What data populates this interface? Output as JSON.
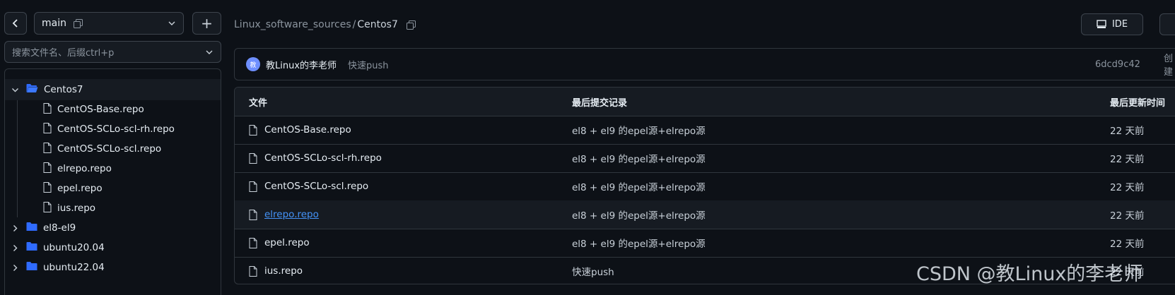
{
  "sidebar": {
    "branch": "main",
    "plus_label": "+",
    "search_placeholder": "搜索文件名、后缀ctrl+p",
    "tree": [
      {
        "label": "Centos7",
        "kind": "folder-open",
        "level": 0,
        "selected": true
      },
      {
        "label": "CentOS-Base.repo",
        "kind": "file",
        "level": 1
      },
      {
        "label": "CentOS-SCLo-scl-rh.repo",
        "kind": "file",
        "level": 1
      },
      {
        "label": "CentOS-SCLo-scl.repo",
        "kind": "file",
        "level": 1
      },
      {
        "label": "elrepo.repo",
        "kind": "file",
        "level": 1
      },
      {
        "label": "epel.repo",
        "kind": "file",
        "level": 1
      },
      {
        "label": "ius.repo",
        "kind": "file",
        "level": 1
      },
      {
        "label": "el8-el9",
        "kind": "folder",
        "level": 0
      },
      {
        "label": "ubuntu20.04",
        "kind": "folder",
        "level": 0
      },
      {
        "label": "ubuntu22.04",
        "kind": "folder",
        "level": 0
      }
    ]
  },
  "breadcrumb": {
    "parent": "Linux_software_sources",
    "sep": "/",
    "current": "Centos7"
  },
  "toolbar": {
    "ide_label": "IDE"
  },
  "commit": {
    "avatar_text": "教",
    "author": "教Linux的李老师",
    "message": "快速push",
    "hash": "6dcd9c42",
    "created": "创建"
  },
  "table": {
    "headers": {
      "file": "文件",
      "commit": "最后提交记录",
      "updated": "最后更新时间"
    },
    "rows": [
      {
        "name": "CentOS-Base.repo",
        "commit": "el8 + el9 的epel源+elrepo源",
        "time": "22 天前"
      },
      {
        "name": "CentOS-SCLo-scl-rh.repo",
        "commit": "el8 + el9 的epel源+elrepo源",
        "time": "22 天前"
      },
      {
        "name": "CentOS-SCLo-scl.repo",
        "commit": "el8 + el9 的epel源+elrepo源",
        "time": "22 天前"
      },
      {
        "name": "elrepo.repo",
        "commit": "el8 + el9 的epel源+elrepo源",
        "time": "22 天前",
        "hovered": true
      },
      {
        "name": "epel.repo",
        "commit": "el8 + el9 的epel源+elrepo源",
        "time": "22 天前"
      },
      {
        "name": "ius.repo",
        "commit": "快速push",
        "time": "22 天前"
      }
    ]
  },
  "watermark": "CSDN @教Linux的李老师",
  "colors": {
    "background": "#0d1117",
    "link": "#4493f8",
    "folder": "#2f6bff",
    "border": "#30363d"
  }
}
